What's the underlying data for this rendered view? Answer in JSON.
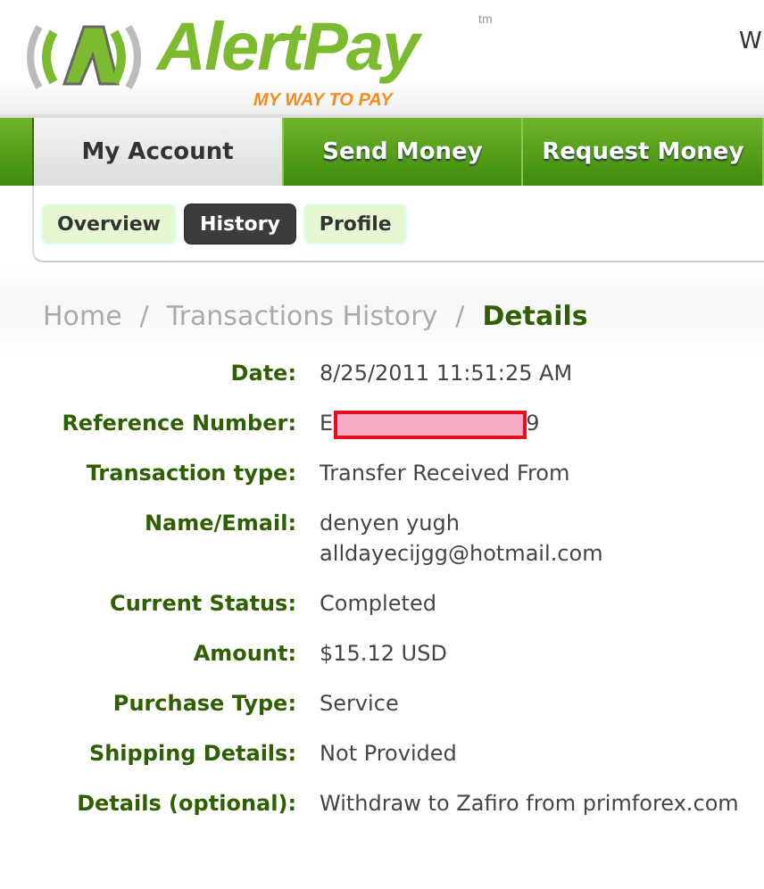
{
  "logo": {
    "name": "AlertPay",
    "trademark": "tm",
    "tagline": "MY WAY TO PAY"
  },
  "header_cut_text": "W",
  "nav_tabs": [
    {
      "label": "My Account",
      "selected": true
    },
    {
      "label": "Send Money",
      "selected": false
    },
    {
      "label": "Request Money",
      "selected": false
    }
  ],
  "sub_tabs": [
    {
      "label": "Overview",
      "selected": false
    },
    {
      "label": "History",
      "selected": true
    },
    {
      "label": "Profile",
      "selected": false
    }
  ],
  "breadcrumb_separator": "/",
  "breadcrumb": [
    {
      "label": "Home",
      "current": false
    },
    {
      "label": "Transactions History",
      "current": false
    },
    {
      "label": "Details",
      "current": true
    }
  ],
  "details": [
    {
      "label": "Date:",
      "kind": "text",
      "value": "8/25/2011 11:51:25 AM"
    },
    {
      "label": "Reference Number:",
      "kind": "redacted",
      "prefix": "E",
      "suffix": "9"
    },
    {
      "label": "Transaction type:",
      "kind": "text",
      "value": "Transfer Received From"
    },
    {
      "label": "Name/Email:",
      "kind": "lines",
      "lines": [
        "denyen yugh",
        "alldayecijgg@hotmail.com"
      ]
    },
    {
      "label": "Current Status:",
      "kind": "text",
      "value": "Completed"
    },
    {
      "label": "Amount:",
      "kind": "text",
      "value": "$15.12 USD"
    },
    {
      "label": "Purchase Type:",
      "kind": "text",
      "value": "Service"
    },
    {
      "label": "Shipping Details:",
      "kind": "text",
      "value": "Not Provided"
    },
    {
      "label": "Details (optional):",
      "kind": "text",
      "value": "Withdraw to Zafiro from primforex.com"
    }
  ]
}
